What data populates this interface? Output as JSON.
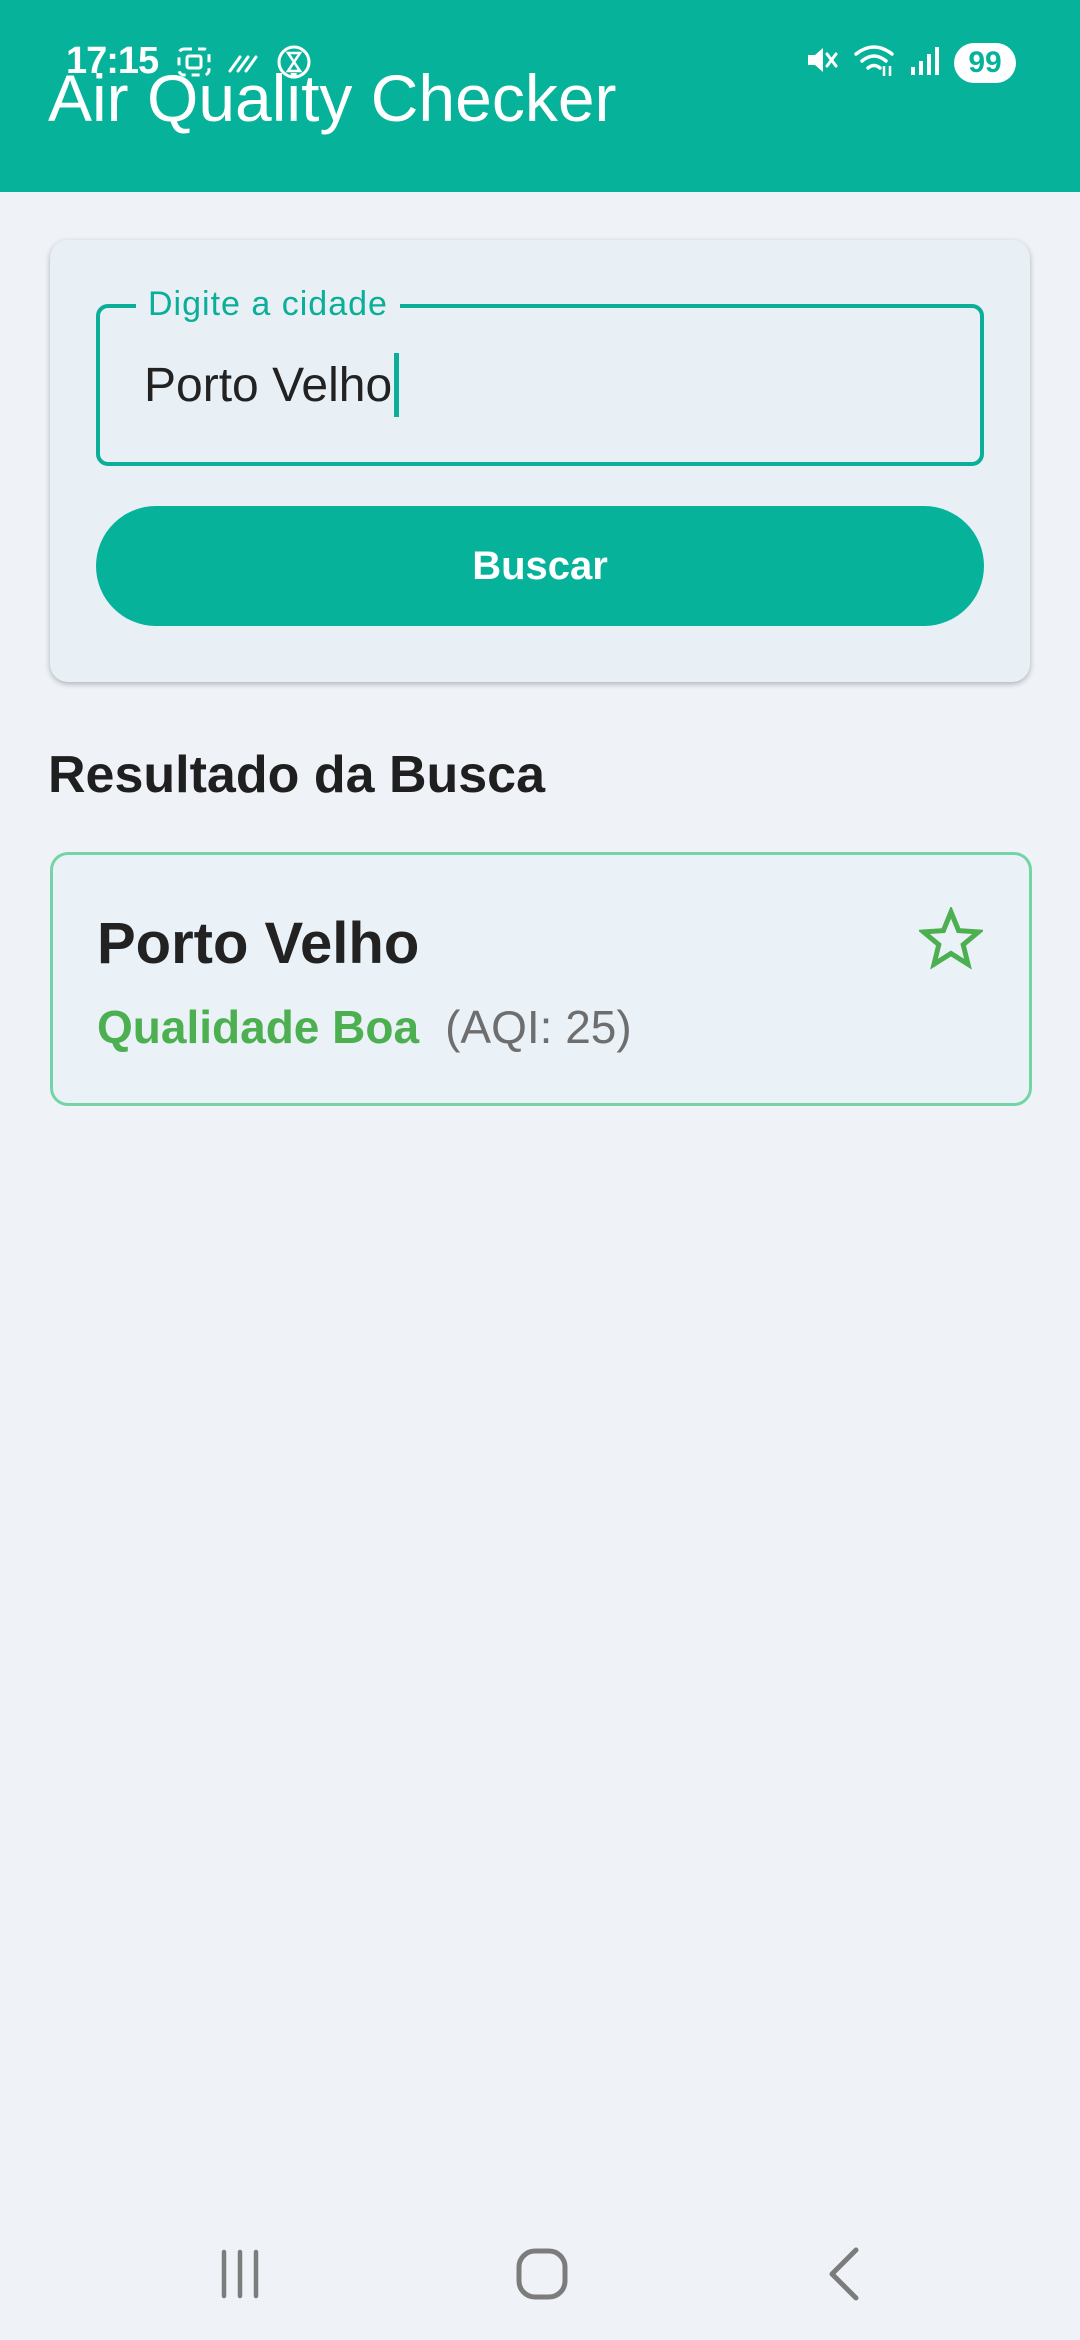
{
  "status_bar": {
    "time": "17:15",
    "battery": "99"
  },
  "app_bar": {
    "title": "Air Quality Checker"
  },
  "search": {
    "label": "Digite a cidade",
    "value": "Porto Velho",
    "button_label": "Buscar"
  },
  "results": {
    "section_title": "Resultado da Busca",
    "items": [
      {
        "city": "Porto Velho",
        "quality": "Qualidade Boa",
        "aqi": "(AQI: 25)",
        "favorite": false
      }
    ]
  },
  "colors": {
    "primary": "#06b39a",
    "good": "#4caf50",
    "background": "#eff3f8"
  },
  "icons": {
    "favorite": "star-outline-icon",
    "nav_recents": "recent-apps-icon",
    "nav_home": "home-icon",
    "nav_back": "back-icon"
  }
}
